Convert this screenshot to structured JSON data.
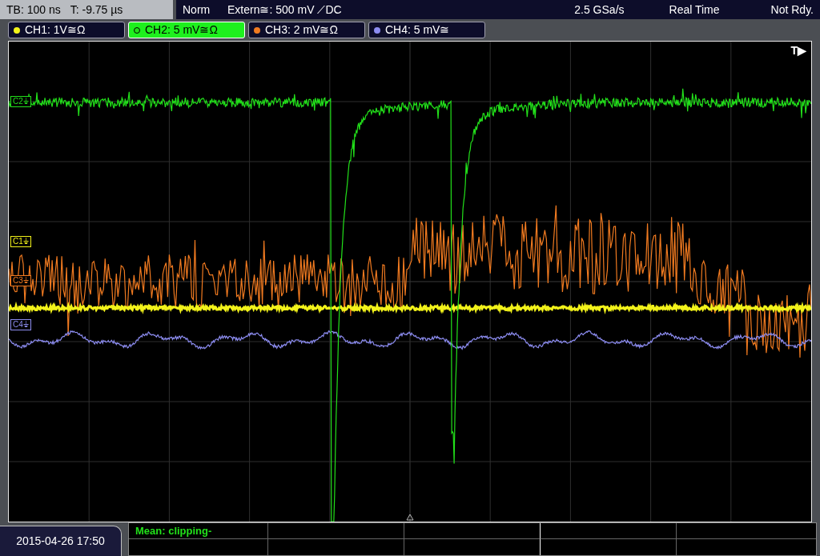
{
  "status_bar": {
    "timebase": "TB: 100 ns",
    "trigger_time": "T: -9.75 µs",
    "mode": "Norm",
    "trigger_source": "Extern≅: 500 mV ⟋DC",
    "sample_rate": "2.5 GSa/s",
    "acquisition": "Real Time",
    "state": "Not Rdy."
  },
  "channels": [
    {
      "label": "CH1: 1V≅Ω",
      "color": "#f2f21a",
      "selected": false
    },
    {
      "label": "CH2: 5 mV≅Ω",
      "color": "#22e01a",
      "selected": true
    },
    {
      "label": "CH3: 2 mV≅Ω",
      "color": "#f07a20",
      "selected": false
    },
    {
      "label": "CH4: 5 mV≅",
      "color": "#8c8cf0",
      "selected": false
    }
  ],
  "markers": [
    {
      "label": "C2⏚",
      "color": "#22e01a"
    },
    {
      "label": "C1⏚",
      "color": "#f2f21a"
    },
    {
      "label": "C3⏚",
      "color": "#f07a20"
    },
    {
      "label": "C4⏚",
      "color": "#8c8cf0"
    }
  ],
  "trigger_label": "T▶",
  "measurements": {
    "rows": [
      [
        "Mean: clipping-"
      ]
    ]
  },
  "date_time": "2015-04-26 17:50"
}
